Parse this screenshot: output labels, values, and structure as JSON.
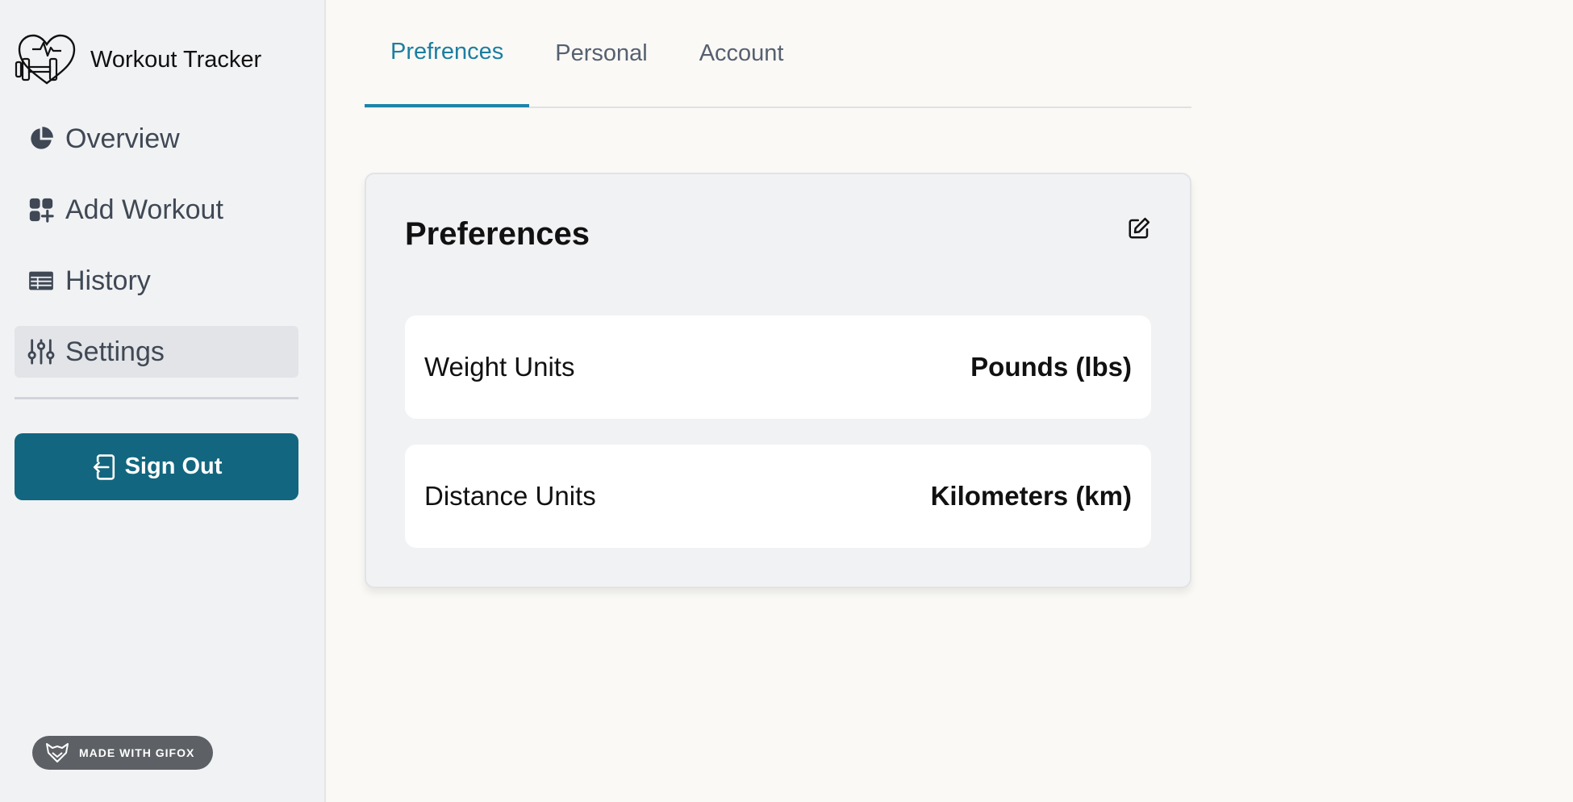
{
  "app": {
    "name": "Workout Tracker"
  },
  "sidebar": {
    "items": [
      {
        "label": "Overview",
        "icon": "pie-chart-icon",
        "active": false
      },
      {
        "label": "Add Workout",
        "icon": "add-grid-icon",
        "active": false
      },
      {
        "label": "History",
        "icon": "table-icon",
        "active": false
      },
      {
        "label": "Settings",
        "icon": "sliders-icon",
        "active": true
      }
    ],
    "signout_label": "Sign Out"
  },
  "tabs": [
    {
      "label": "Prefrences",
      "active": true
    },
    {
      "label": "Personal",
      "active": false
    },
    {
      "label": "Account",
      "active": false
    }
  ],
  "card": {
    "title": "Preferences",
    "rows": [
      {
        "label": "Weight Units",
        "value": "Pounds (lbs)"
      },
      {
        "label": "Distance Units",
        "value": "Kilometers (km)"
      }
    ]
  },
  "badge": {
    "label": "MADE WITH GIFOX"
  },
  "colors": {
    "accent": "#1c85a7",
    "signout_bg": "#13667f",
    "sidebar_bg": "#f1f2f4",
    "main_bg": "#faf9f6"
  }
}
